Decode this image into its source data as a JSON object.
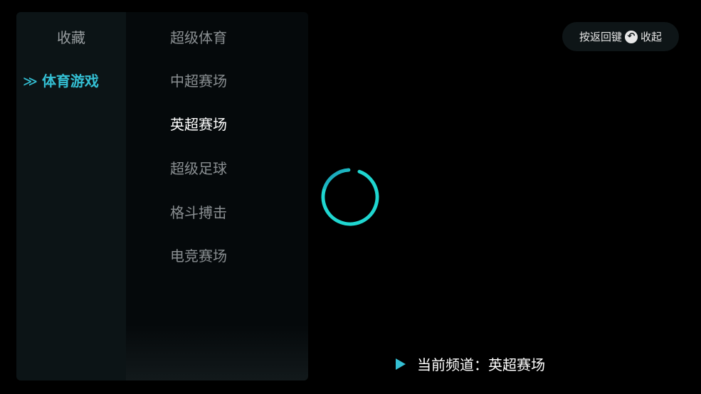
{
  "categories": [
    {
      "label": "收藏",
      "active": false
    },
    {
      "label": "体育游戏",
      "active": true
    }
  ],
  "active_arrow": "≫",
  "channels": [
    {
      "label": "超级体育",
      "selected": false
    },
    {
      "label": "中超赛场",
      "selected": false
    },
    {
      "label": "英超赛场",
      "selected": true
    },
    {
      "label": "超级足球",
      "selected": false
    },
    {
      "label": "格斗搏击",
      "selected": false
    },
    {
      "label": "电竞赛场",
      "selected": false
    }
  ],
  "hint": {
    "prefix": "按返回键",
    "suffix": "收起",
    "icon": "back-arrow-icon"
  },
  "current_channel": {
    "label": "当前频道：",
    "value": "英超赛场"
  },
  "colors": {
    "accent": "#34bfd3",
    "spinner": "#1fd6d0"
  }
}
